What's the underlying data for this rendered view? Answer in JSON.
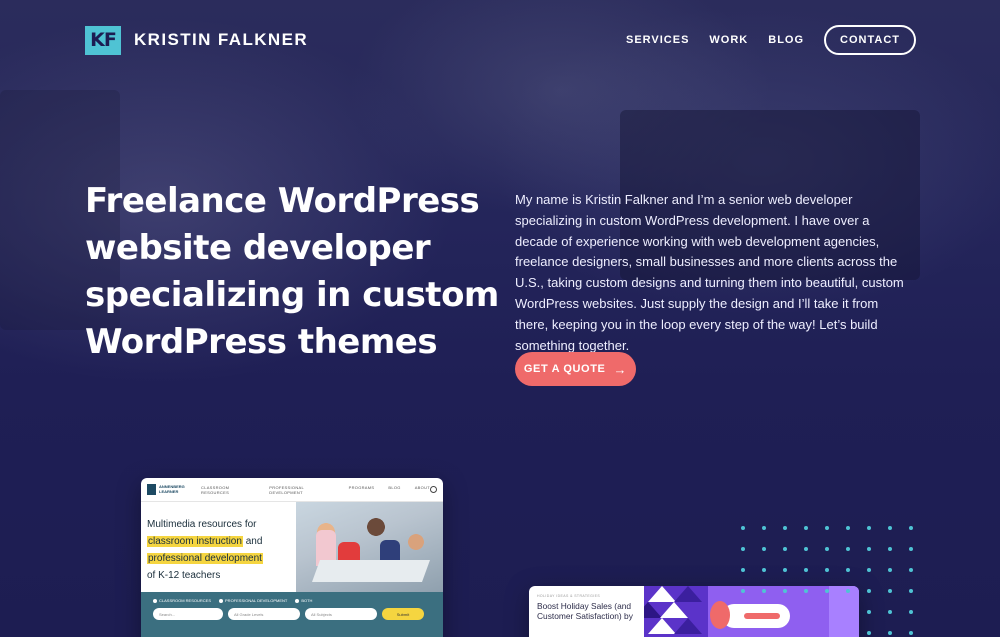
{
  "brand": {
    "logo_text": "KF",
    "name": "KRISTIN FALKNER",
    "accent": "#4fc3d4"
  },
  "nav": {
    "items": [
      "SERVICES",
      "WORK",
      "BLOG"
    ],
    "contact": "CONTACT"
  },
  "hero": {
    "headline": "Freelance WordPress website developer specializing in custom WordPress themes",
    "intro": "My name is Kristin Falkner and I’m a senior web developer specializing in custom WordPress development. I have over a decade of experience working with web development agencies, freelance designers, small businesses and more clients across the U.S., taking custom designs and turning them into beautiful, custom WordPress websites. Just supply the design and I’ll take it from there, keeping you in the loop every step of the way! Let’s build something together.",
    "cta": "GET A QUOTE",
    "cta_color": "#ef6a6a"
  },
  "portfolio": {
    "left": {
      "logo": "ANNENBERG LEARNER",
      "nav": [
        "CLASSROOM RESOURCES",
        "PROFESSIONAL DEVELOPMENT",
        "PROGRAMS",
        "BLOG",
        "ABOUT"
      ],
      "line1": "Multimedia resources for",
      "hl1": "classroom instruction",
      "and": "and",
      "hl2": "professional development",
      "line4": "of K-12 teachers",
      "radios": [
        "CLASSROOM RESOURCES",
        "PROFESSIONAL DEVELOPMENT",
        "BOTH"
      ],
      "inputs": [
        "Search...",
        "All Grade Levels",
        "All Subjects"
      ],
      "submit": "Submit"
    },
    "right": {
      "kicker": "HOLIDAY IDEAS & STRATEGIES",
      "title": "Boost Holiday Sales (and Customer Satisfaction) by"
    }
  },
  "icons": {
    "arrow": "arrow-right-icon",
    "search": "search-icon"
  }
}
